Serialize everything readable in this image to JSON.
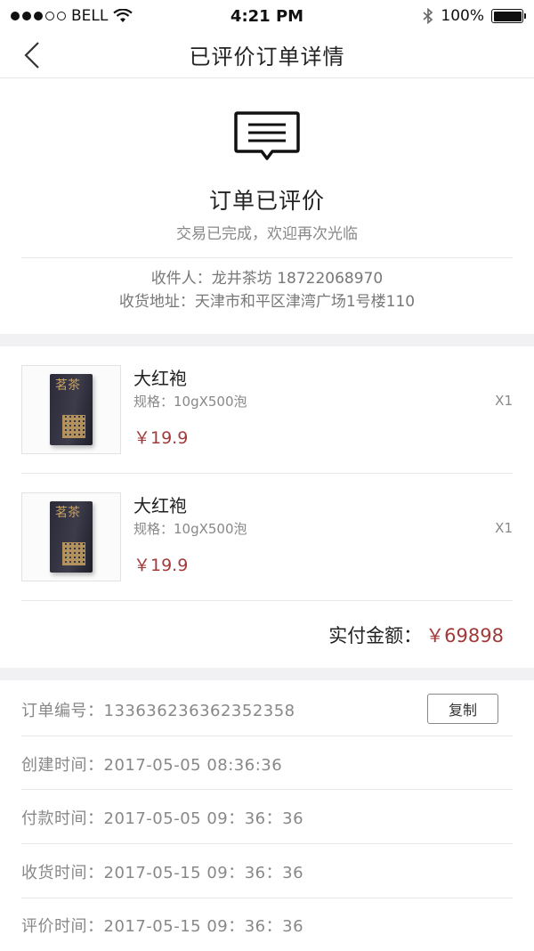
{
  "status_bar": {
    "carrier": "BELL",
    "time": "4:21 PM",
    "battery": "100%",
    "icons": [
      "signal-dots",
      "wifi-icon",
      "bluetooth-icon",
      "battery-icon"
    ]
  },
  "nav": {
    "title": "已评价订单详情",
    "back_icon": "chevron-left-icon"
  },
  "order_status": {
    "icon": "message-icon",
    "title": "订单已评价",
    "subtitle": "交易已完成，欢迎再次光临"
  },
  "address": {
    "receiver": "收件人：龙井茶坊 18722068970",
    "address": "收货地址：天津市和平区津湾广场1号楼110"
  },
  "products": [
    {
      "name": "大红袍",
      "spec": "规格：10gX500泡",
      "price": "￥19.9",
      "qty": "X1",
      "image_glyph": "茗茶"
    },
    {
      "name": "大红袍",
      "spec": "规格：10gX500泡",
      "price": "￥19.9",
      "qty": "X1",
      "image_glyph": "茗茶"
    }
  ],
  "total": {
    "label": "实付金额：",
    "amount": "￥69898"
  },
  "order_info": {
    "order_no": "订单编号：133636236362352358",
    "copy_label": "复制",
    "created": "创建时间：2017-05-05 08:36:36",
    "paid": "付款时间：2017-05-05 09：36：36",
    "received": "收货时间：2017-05-15 09：36：36",
    "reviewed": "评价时间：2017-05-15 09：36：36"
  },
  "colors": {
    "accent": "#a23a3a",
    "muted_text": "#888888",
    "divider": "#e6e6e6",
    "section_gap": "#f1f1f4"
  }
}
